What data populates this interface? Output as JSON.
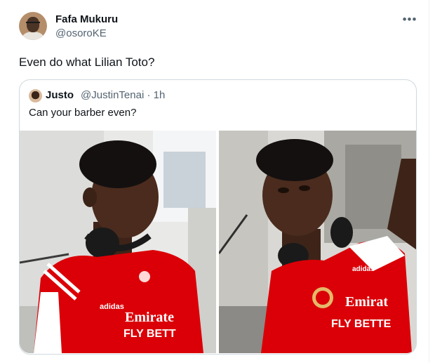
{
  "tweet": {
    "author_name": "Fafa Mukuru",
    "author_handle": "@osoroKE",
    "more_icon": "more-horizontal-icon",
    "text": "Even do what Lilian Toto?"
  },
  "quote": {
    "author_name": "Justo",
    "author_handle": "@JustinTenai",
    "separator": "·",
    "time": "1h",
    "text": "Can your barber even?",
    "photos": [
      {
        "shirt_sponsor_line1": "Emirate",
        "shirt_sponsor_line2": "FLY BETT"
      },
      {
        "shirt_sponsor_line1": "Emirat",
        "shirt_sponsor_line2": "FLY BETTE"
      }
    ]
  },
  "colors": {
    "text": "#0f1419",
    "secondary": "#536471",
    "border": "#cfd9de",
    "arsenal_red": "#db0007"
  }
}
